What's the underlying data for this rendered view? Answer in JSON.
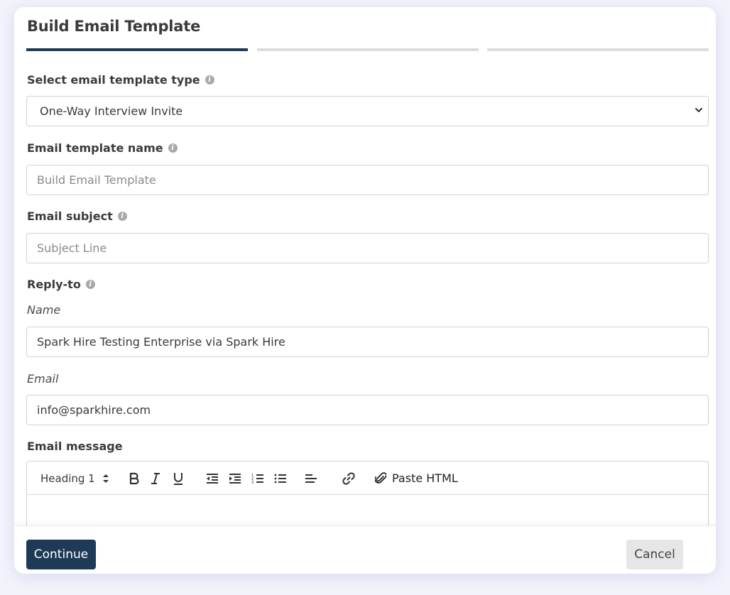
{
  "dialog": {
    "title": "Build Email Template",
    "step_colors": {
      "active": "#1f3a56",
      "inactive": "#dcdcdc"
    }
  },
  "template_type": {
    "label": "Select email template type",
    "selected": "One-Way Interview Invite"
  },
  "template_name": {
    "label": "Email template name",
    "placeholder": "Build Email Template"
  },
  "subject": {
    "label": "Email subject",
    "placeholder": "Subject Line"
  },
  "reply_to": {
    "label": "Reply-to",
    "name_label": "Name",
    "name_value": "Spark Hire Testing Enterprise via Spark Hire",
    "email_label": "Email",
    "email_value": "info@sparkhire.com"
  },
  "message": {
    "label": "Email message",
    "toolbar": {
      "heading": "Heading 1",
      "paste_html": "Paste HTML",
      "icons": [
        "bold-icon",
        "italic-icon",
        "underline-icon",
        "outdent-icon",
        "indent-icon",
        "ordered-list-icon",
        "bullet-list-icon",
        "align-left-icon",
        "link-icon",
        "paperclip-icon"
      ]
    }
  },
  "footer": {
    "continue_label": "Continue",
    "cancel_label": "Cancel"
  }
}
